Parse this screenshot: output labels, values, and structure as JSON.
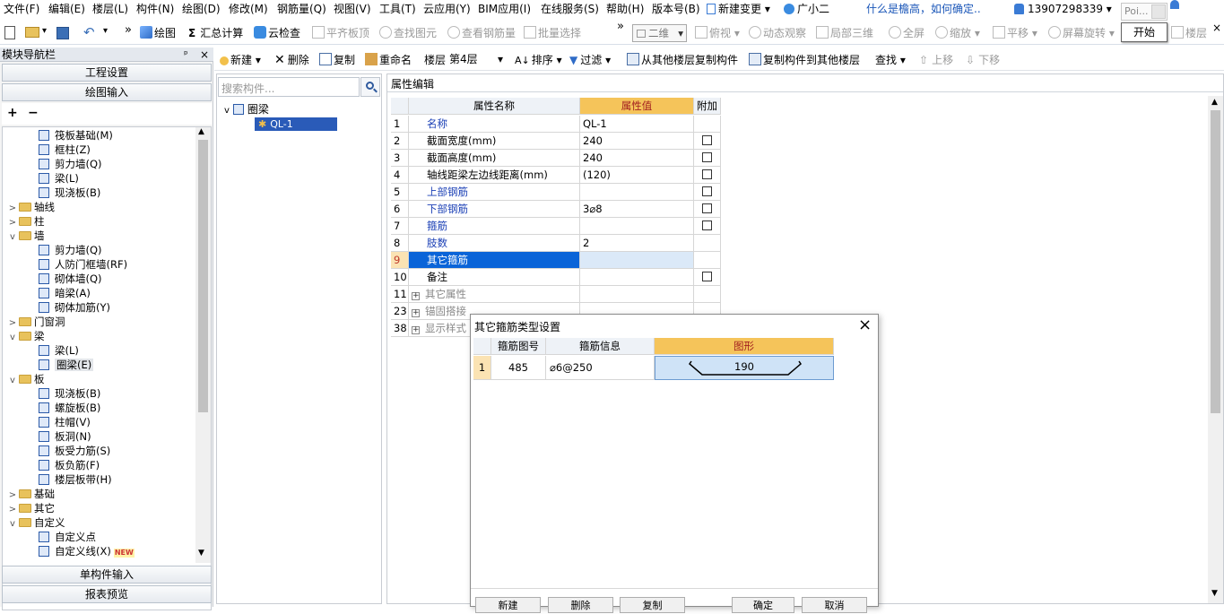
{
  "menubar": {
    "items": [
      "文件(F)",
      "编辑(E)",
      "楼层(L)",
      "构件(N)",
      "绘图(D)",
      "修改(M)",
      "钢筋量(Q)",
      "视图(V)",
      "工具(T)",
      "云应用(Y)",
      "BIM应用(I)",
      "在线服务(S)",
      "帮助(H)",
      "版本号(B)"
    ],
    "new_change": "新建变更",
    "guangxiaoer": "广小二",
    "help_link": "什么是檐高，如何确定..",
    "phone": "13907298339",
    "poi": "Poi...",
    "start_button": "开始"
  },
  "toolbar1": {
    "draw": "绘图",
    "sum_calc": "汇总计算",
    "cloud_check": "云检查",
    "align_top": "平齐板顶",
    "find_element": "查找图元",
    "view_rebar": "查看钢筋量",
    "batch_select": "批量选择",
    "view_mode": "二维",
    "top_view": "俯视",
    "dyn_view": "动态观察",
    "local_3d": "局部三维",
    "fullscreen": "全屏",
    "zoom": "缩放",
    "pan": "平移",
    "rotate": "屏幕旋转",
    "floor_tail": "楼层"
  },
  "nav": {
    "title": "模块导航栏",
    "pin": "ᵖ",
    "close": "×",
    "project_settings": "工程设置",
    "drawing_input": "绘图输入",
    "single_input": "单构件输入",
    "report_preview": "报表预览",
    "tree": [
      {
        "label": "筏板基础(M)",
        "level": 2,
        "icon": "leaf"
      },
      {
        "label": "框柱(Z)",
        "level": 2,
        "icon": "leaf"
      },
      {
        "label": "剪力墙(Q)",
        "level": 2,
        "icon": "leaf"
      },
      {
        "label": "梁(L)",
        "level": 2,
        "icon": "leaf"
      },
      {
        "label": "现浇板(B)",
        "level": 2,
        "icon": "leaf"
      },
      {
        "label": "轴线",
        "level": 1,
        "icon": "folder",
        "exp": ">"
      },
      {
        "label": "柱",
        "level": 1,
        "icon": "folder",
        "exp": ">"
      },
      {
        "label": "墙",
        "level": 1,
        "icon": "folder",
        "exp": "v"
      },
      {
        "label": "剪力墙(Q)",
        "level": 2,
        "icon": "leaf"
      },
      {
        "label": "人防门框墙(RF)",
        "level": 2,
        "icon": "leaf"
      },
      {
        "label": "砌体墙(Q)",
        "level": 2,
        "icon": "leaf"
      },
      {
        "label": "暗梁(A)",
        "level": 2,
        "icon": "leaf"
      },
      {
        "label": "砌体加筋(Y)",
        "level": 2,
        "icon": "leaf"
      },
      {
        "label": "门窗洞",
        "level": 1,
        "icon": "folder",
        "exp": ">"
      },
      {
        "label": "梁",
        "level": 1,
        "icon": "folder",
        "exp": "v"
      },
      {
        "label": "梁(L)",
        "level": 2,
        "icon": "leaf"
      },
      {
        "label": "圈梁(E)",
        "level": 2,
        "icon": "leaf",
        "selected": true
      },
      {
        "label": "板",
        "level": 1,
        "icon": "folder",
        "exp": "v"
      },
      {
        "label": "现浇板(B)",
        "level": 2,
        "icon": "leaf"
      },
      {
        "label": "螺旋板(B)",
        "level": 2,
        "icon": "leaf"
      },
      {
        "label": "柱帽(V)",
        "level": 2,
        "icon": "leaf"
      },
      {
        "label": "板洞(N)",
        "level": 2,
        "icon": "leaf"
      },
      {
        "label": "板受力筋(S)",
        "level": 2,
        "icon": "leaf"
      },
      {
        "label": "板负筋(F)",
        "level": 2,
        "icon": "leaf"
      },
      {
        "label": "楼层板带(H)",
        "level": 2,
        "icon": "leaf"
      },
      {
        "label": "基础",
        "level": 1,
        "icon": "folder",
        "exp": ">"
      },
      {
        "label": "其它",
        "level": 1,
        "icon": "folder",
        "exp": ">"
      },
      {
        "label": "自定义",
        "level": 1,
        "icon": "folder",
        "exp": "v"
      },
      {
        "label": "自定义点",
        "level": 2,
        "icon": "leaf"
      },
      {
        "label": "自定义线(X)",
        "level": 2,
        "icon": "leaf",
        "badge": "NEW"
      }
    ]
  },
  "toolbar2": {
    "new": "新建",
    "delete": "删除",
    "copy": "复制",
    "rename": "重命名",
    "floor_label": "楼层",
    "floor_value": "第4层",
    "sort": "排序",
    "filter": "过滤",
    "copy_from_floor": "从其他楼层复制构件",
    "copy_to_floor": "复制构件到其他楼层",
    "find": "查找",
    "move_up": "上移",
    "move_down": "下移"
  },
  "component_panel": {
    "search_placeholder": "搜索构件...",
    "root": "圈梁",
    "child": "QL-1"
  },
  "property": {
    "tab": "属性编辑",
    "headers": [
      "属性名称",
      "属性值",
      "附加"
    ],
    "rows": [
      {
        "no": "1",
        "name": "名称",
        "value": "QL-1",
        "blue": true,
        "check": false
      },
      {
        "no": "2",
        "name": "截面宽度(mm)",
        "value": "240",
        "blue": false,
        "check": true
      },
      {
        "no": "3",
        "name": "截面高度(mm)",
        "value": "240",
        "blue": false,
        "check": true
      },
      {
        "no": "4",
        "name": "轴线距梁左边线距离(mm)",
        "value": "(120)",
        "blue": false,
        "check": true
      },
      {
        "no": "5",
        "name": "上部钢筋",
        "value": "",
        "blue": true,
        "check": true
      },
      {
        "no": "6",
        "name": "下部钢筋",
        "value": "3⌀8",
        "blue": true,
        "check": true
      },
      {
        "no": "7",
        "name": "箍筋",
        "value": "",
        "blue": true,
        "check": true
      },
      {
        "no": "8",
        "name": "肢数",
        "value": "2",
        "blue": true,
        "check": false
      },
      {
        "no": "9",
        "name": "其它箍筋",
        "value": "",
        "blue": true,
        "check": false,
        "selected": true
      },
      {
        "no": "10",
        "name": "备注",
        "value": "",
        "blue": false,
        "check": true
      },
      {
        "no": "11",
        "name": "其它属性",
        "value": "",
        "blue": false,
        "group": true
      },
      {
        "no": "23",
        "name": "锚固搭接",
        "value": "",
        "blue": false,
        "group": true
      },
      {
        "no": "38",
        "name": "显示样式",
        "value": "",
        "blue": false,
        "group": true
      }
    ]
  },
  "dialog": {
    "title": "其它箍筋类型设置",
    "close": "×",
    "headers": [
      "箍筋图号",
      "箍筋信息",
      "图形"
    ],
    "rows": [
      {
        "no": "1",
        "code": "485",
        "info": "⌀6@250",
        "shape_value": "190"
      }
    ],
    "buttons": [
      "新建",
      "删除",
      "复制",
      "确定",
      "取消"
    ]
  }
}
